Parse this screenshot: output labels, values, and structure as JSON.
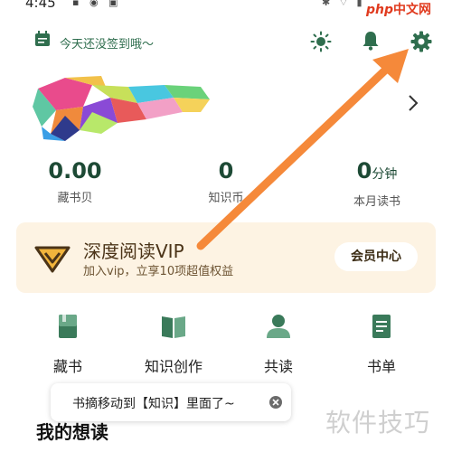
{
  "status_bar": {
    "time": "4:45"
  },
  "watermark_logo": {
    "part1": "php",
    "part2": "中文网"
  },
  "header": {
    "signin_text": "今天还没签到哦～"
  },
  "stats": [
    {
      "value": "0.00",
      "unit": "",
      "label": "藏书贝"
    },
    {
      "value": "0",
      "unit": "",
      "label": "知识币"
    },
    {
      "value": "0",
      "unit": "分钟",
      "label": "本月读书"
    }
  ],
  "vip": {
    "title": "深度阅读VIP",
    "subtitle": "加入vip，立享10项超值权益",
    "button": "会员中心"
  },
  "menu": [
    {
      "label": "藏书",
      "icon": "book-icon"
    },
    {
      "label": "知识创作",
      "icon": "open-book-icon"
    },
    {
      "label": "共读",
      "icon": "person-icon"
    },
    {
      "label": "书单",
      "icon": "list-icon"
    }
  ],
  "toast": {
    "text": "书摘移动到【知识】里面了~"
  },
  "section": {
    "title": "我的想读"
  },
  "watermark": {
    "text": "软件技巧"
  },
  "colors": {
    "accent_green": "#2f6e4e",
    "vip_bg": "#fdf3e3",
    "arrow": "#f5893a"
  }
}
